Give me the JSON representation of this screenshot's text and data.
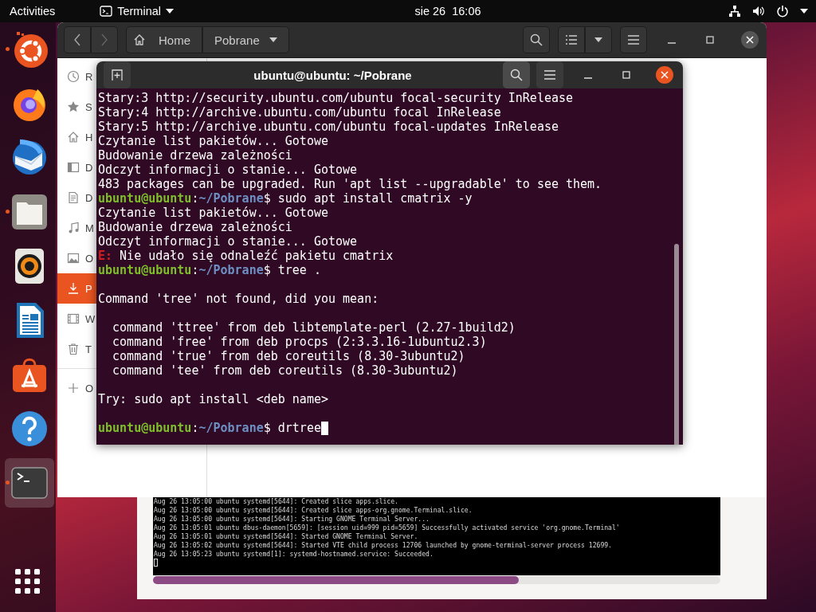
{
  "top_bar": {
    "activities": "Activities",
    "app_menu": "Terminal",
    "clock": "sie 26  16:06"
  },
  "dock": {
    "items": [
      {
        "kind": "ubuntu",
        "running": true,
        "selected": false
      },
      {
        "kind": "firefox",
        "running": false,
        "selected": false
      },
      {
        "kind": "thunderbird",
        "running": false,
        "selected": false
      },
      {
        "kind": "files",
        "running": true,
        "selected": false
      },
      {
        "kind": "rhythmbox",
        "running": false,
        "selected": false
      },
      {
        "kind": "writer",
        "running": false,
        "selected": false
      },
      {
        "kind": "software",
        "running": false,
        "selected": false
      },
      {
        "kind": "help",
        "running": false,
        "selected": false
      },
      {
        "kind": "terminal",
        "running": true,
        "selected": true
      }
    ]
  },
  "files_window": {
    "path": [
      "Home",
      "Pobrane"
    ],
    "sidebar": [
      {
        "kind": "recent",
        "label": "R",
        "selected": false
      },
      {
        "kind": "starred",
        "label": "S",
        "selected": false
      },
      {
        "kind": "home",
        "label": "H",
        "selected": false
      },
      {
        "kind": "desktop",
        "label": "D",
        "selected": false
      },
      {
        "kind": "documents",
        "label": "D",
        "selected": false
      },
      {
        "kind": "music",
        "label": "M",
        "selected": false
      },
      {
        "kind": "pictures",
        "label": "O",
        "selected": false
      },
      {
        "kind": "downloads",
        "label": "P",
        "selected": true
      },
      {
        "kind": "videos",
        "label": "W",
        "selected": false
      },
      {
        "kind": "trash",
        "label": "T",
        "selected": false
      },
      {
        "kind": "other",
        "label": "O",
        "selected": false
      }
    ]
  },
  "terminal_window": {
    "title": "ubuntu@ubuntu: ~/Pobrane",
    "lines": [
      {
        "kind": "output",
        "text": "Stary:3 http://security.ubuntu.com/ubuntu focal-security InRelease"
      },
      {
        "kind": "output",
        "text": "Stary:4 http://archive.ubuntu.com/ubuntu focal InRelease"
      },
      {
        "kind": "output",
        "text": "Stary:5 http://archive.ubuntu.com/ubuntu focal-updates InRelease"
      },
      {
        "kind": "output",
        "text": "Czytanie list pakietów... Gotowe"
      },
      {
        "kind": "output",
        "text": "Budowanie drzewa zależności"
      },
      {
        "kind": "output",
        "text": "Odczyt informacji o stanie... Gotowe"
      },
      {
        "kind": "output",
        "text": "483 packages can be upgraded. Run 'apt list --upgradable' to see them."
      },
      {
        "kind": "prompt",
        "user": "ubuntu@ubuntu",
        "separator": ":",
        "path": "~/Pobrane",
        "symbol": "$",
        "command": "sudo apt install cmatrix -y",
        "cursor": false
      },
      {
        "kind": "output",
        "text": "Czytanie list pakietów... Gotowe"
      },
      {
        "kind": "output",
        "text": "Budowanie drzewa zależności"
      },
      {
        "kind": "output",
        "text": "Odczyt informacji o stanie... Gotowe"
      },
      {
        "kind": "error",
        "prefix": "E:",
        "text": "Nie udało się odnaleźć pakietu cmatrix"
      },
      {
        "kind": "prompt",
        "user": "ubuntu@ubuntu",
        "separator": ":",
        "path": "~/Pobrane",
        "symbol": "$",
        "command": "tree .",
        "cursor": false
      },
      {
        "kind": "blank"
      },
      {
        "kind": "output",
        "text": "Command 'tree' not found, did you mean:"
      },
      {
        "kind": "blank"
      },
      {
        "kind": "output",
        "text": "  command 'ttree' from deb libtemplate-perl (2.27-1build2)"
      },
      {
        "kind": "output",
        "text": "  command 'free' from deb procps (2:3.3.16-1ubuntu2.3)"
      },
      {
        "kind": "output",
        "text": "  command 'true' from deb coreutils (8.30-3ubuntu2)"
      },
      {
        "kind": "output",
        "text": "  command 'tee' from deb coreutils (8.30-3ubuntu2)"
      },
      {
        "kind": "blank"
      },
      {
        "kind": "output",
        "text": "Try: sudo apt install <deb name>"
      },
      {
        "kind": "blank"
      },
      {
        "kind": "prompt",
        "user": "ubuntu@ubuntu",
        "separator": ":",
        "path": "~/Pobrane",
        "symbol": "$",
        "command": "drtree",
        "cursor": true
      }
    ]
  },
  "log_window": {
    "lines": [
      "Aug 26 13:05:00 ubuntu systemd[5644]: Created slice apps.slice.",
      "Aug 26 13:05:00 ubuntu systemd[5644]: Created slice apps-org.gnome.Terminal.slice.",
      "Aug 26 13:05:00 ubuntu systemd[5644]: Starting GNOME Terminal Server...",
      "Aug 26 13:05:01 ubuntu dbus-daemon[5659]: [session uid=999 pid=5659] Successfully activated service 'org.gnome.Terminal'",
      "Aug 26 13:05:01 ubuntu systemd[5644]: Started GNOME Terminal Server.",
      "Aug 26 13:05:02 ubuntu systemd[5644]: Started VTE child process 12706 launched by gnome-terminal-server process 12699.",
      "Aug 26 13:05:23 ubuntu systemd[1]: systemd-hostnamed.service: Succeeded."
    ],
    "cursor": true
  }
}
